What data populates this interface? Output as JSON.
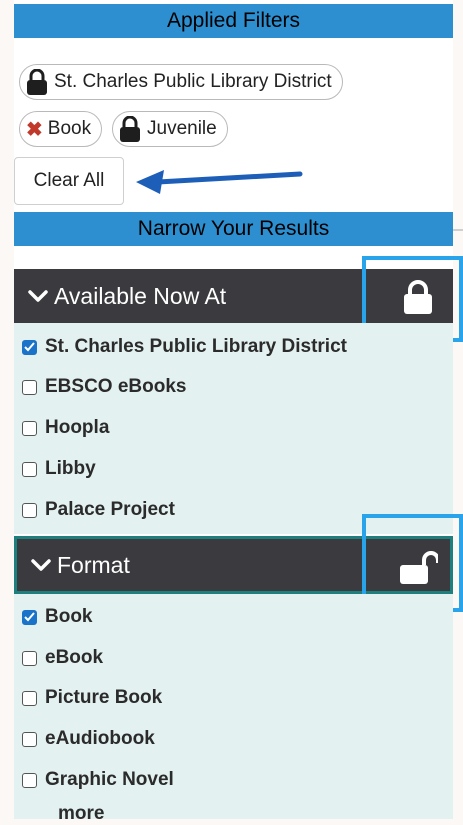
{
  "applied_filters": {
    "title": "Applied Filters",
    "chips": [
      {
        "label": "St. Charles Public Library District",
        "icon": "lock-icon"
      },
      {
        "label": "Book",
        "icon": "remove-x-icon"
      },
      {
        "label": "Juvenile",
        "icon": "lock-icon"
      }
    ],
    "clear_label": "Clear All"
  },
  "narrow": {
    "title": "Narrow Your Results"
  },
  "available": {
    "title": "Available Now At",
    "lock_state": "locked",
    "options": [
      {
        "label": "St. Charles Public Library District",
        "checked": true
      },
      {
        "label": "EBSCO eBooks",
        "checked": false
      },
      {
        "label": "Hoopla",
        "checked": false
      },
      {
        "label": "Libby",
        "checked": false
      },
      {
        "label": "Palace Project",
        "checked": false
      }
    ]
  },
  "format": {
    "title": "Format",
    "lock_state": "unlocked",
    "options": [
      {
        "label": "Book",
        "checked": true
      },
      {
        "label": "eBook",
        "checked": false
      },
      {
        "label": "Picture Book",
        "checked": false
      },
      {
        "label": "eAudiobook",
        "checked": false
      },
      {
        "label": "Graphic Novel",
        "checked": false
      }
    ],
    "more_label": "more"
  },
  "colors": {
    "header_blue": "#2d8fd0",
    "section_dark": "#3b3a3e",
    "section_body": "#e3f1f1",
    "highlight": "#29a3ea",
    "arrow": "#1d5fb8",
    "checked": "#1a73c8"
  }
}
